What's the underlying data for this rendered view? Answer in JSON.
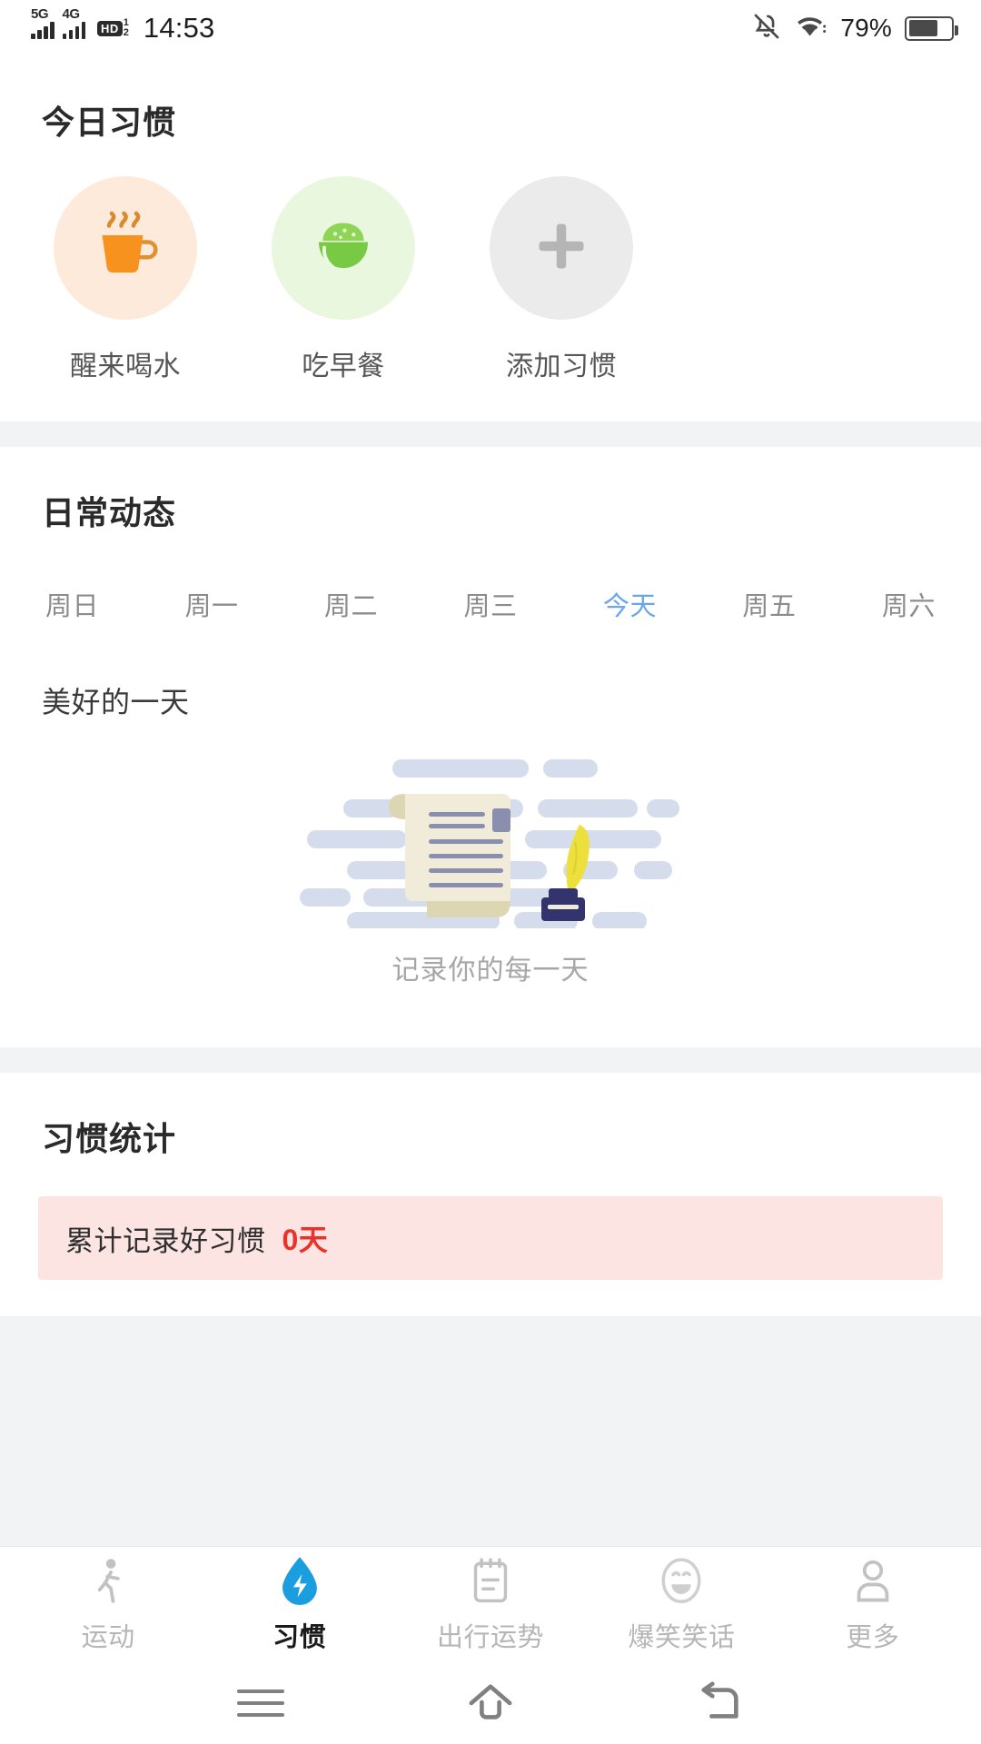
{
  "status_bar": {
    "network_5g": "5G",
    "network_4g": "4G",
    "hd_label": "HD",
    "hd_sup": "1",
    "hd_sub": "2",
    "time": "14:53",
    "battery_percent": "79%",
    "icons": [
      "signal-5g-icon",
      "signal-4g-icon",
      "hd-volte-icon",
      "bell-muted-icon",
      "wifi-icon",
      "battery-icon"
    ]
  },
  "today_habits": {
    "title": "今日习惯",
    "items": [
      {
        "label": "醒来喝水",
        "icon": "cup-of-water-icon",
        "bg": "#fdeadb",
        "color": "#f7921e"
      },
      {
        "label": "吃早餐",
        "icon": "rice-bowl-icon",
        "bg": "#e8f7dd",
        "color": "#78c943"
      },
      {
        "label": "添加习惯",
        "icon": "plus-icon",
        "bg": "#ebebeb",
        "color": "#b5b5b5"
      }
    ]
  },
  "daily_dynamics": {
    "title": "日常动态",
    "weekdays": [
      {
        "label": "周日",
        "active": false
      },
      {
        "label": "周一",
        "active": false
      },
      {
        "label": "周二",
        "active": false
      },
      {
        "label": "周三",
        "active": false
      },
      {
        "label": "今天",
        "active": true
      },
      {
        "label": "周五",
        "active": false
      },
      {
        "label": "周六",
        "active": false
      }
    ],
    "active_color": "#6ba7e8",
    "day_heading": "美好的一天",
    "empty_state": {
      "illustration": "scroll-quill-inkwell-illustration",
      "caption": "记录你的每一天"
    }
  },
  "habit_stats": {
    "title": "习惯统计",
    "banner": {
      "text": "累计记录好习惯",
      "value": "0天",
      "bg": "#fbe4e2",
      "value_color": "#e8322a"
    }
  },
  "bottom_nav": {
    "items": [
      {
        "label": "运动",
        "icon": "walking-person-icon",
        "active": false
      },
      {
        "label": "习惯",
        "icon": "water-drop-bolt-icon",
        "active": true
      },
      {
        "label": "出行运势",
        "icon": "calendar-clipboard-icon",
        "active": false
      },
      {
        "label": "爆笑笑话",
        "icon": "laughing-face-icon",
        "active": false
      },
      {
        "label": "更多",
        "icon": "person-icon",
        "active": false
      }
    ],
    "active_color": "#1a9ee0",
    "inactive_color": "#b6b6b6"
  },
  "android_nav": {
    "items": [
      {
        "icon": "recents-menu-icon"
      },
      {
        "icon": "home-icon"
      },
      {
        "icon": "back-icon"
      }
    ]
  }
}
